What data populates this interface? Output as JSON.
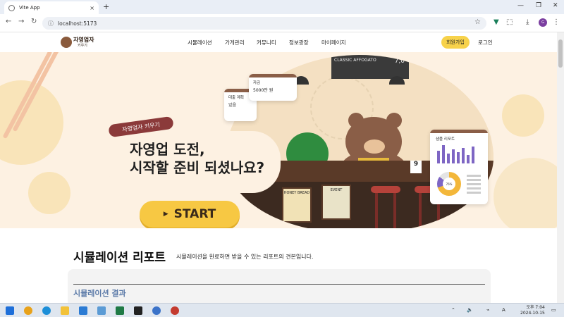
{
  "browser": {
    "tab_title": "Vite App",
    "url": "localhost:5173",
    "new_tab": "+",
    "tab_close": "×"
  },
  "site": {
    "logo_title": "자영업자",
    "logo_sub": "키우기",
    "menu": [
      "시뮬레이션",
      "가게관리",
      "커뮤니티",
      "정보광장",
      "마이페이지"
    ],
    "signup": "회원가입",
    "login": "로그인"
  },
  "hero": {
    "tag": "자영업자 키우기",
    "headline_1": "자영업 도전,",
    "headline_2": "시작할 준비 되셨나요?",
    "start": "START",
    "card_loan_label": "대출 계획",
    "card_loan_value": "있음",
    "card_fund_label": "자금",
    "card_fund_value": "5000만 원",
    "card_report_title": "샘플 리포트",
    "donut_label": "76%",
    "board_text": "CLASSIC AFFOGATO",
    "board_price": "7,0",
    "poster_1": "HONEY BREAD",
    "poster_2": "EVENT",
    "counter_num": "9"
  },
  "report": {
    "title": "시뮬레이션 리포트",
    "subtitle": "시뮬레이션을 완료하면 받을 수 있는 리포트의 견본입니다.",
    "result_heading": "시뮬레이션 결과"
  },
  "taskbar": {
    "time": "오후 7:04",
    "date": "2024-10-15"
  },
  "colors": {
    "accent_yellow": "#f7c843",
    "tag_maroon": "#8b3a3a",
    "hero_bg": "#fdf1e2",
    "report_blue": "#5b7aa8"
  },
  "icons": [
    "back-icon",
    "forward-icon",
    "reload-icon",
    "info-icon",
    "star-icon",
    "extension-icon",
    "download-icon",
    "profile-icon"
  ]
}
